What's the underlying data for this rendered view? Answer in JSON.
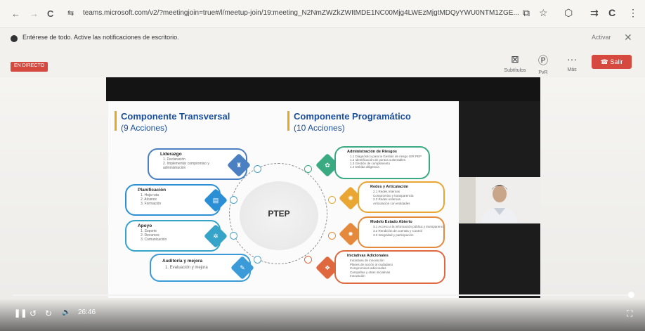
{
  "browser": {
    "url": "teams.microsoft.com/v2/?meetingjoin=true#/l/meetup-join/19:meeting_N2NmZWZkZWItMDE1NC00Mjg4LWEzMjgtMDQyYWU0NTM1ZGE...",
    "back_icon": "←",
    "forward_icon": "→",
    "reload_icon": "C",
    "site_info_icon": "⇆",
    "cast_icon": "⧉",
    "star_icon": "☆",
    "extension_icon": "⬡",
    "tab_search_icon": "⇉",
    "profile_icon": "C",
    "menu_icon": "⋮"
  },
  "notification": {
    "text": "Entérese de todo. Active las notificaciones de escritorio.",
    "activate_label": "Activar",
    "close_icon": "✕"
  },
  "meeting": {
    "live_badge": "EN DIRECTO",
    "controls": [
      {
        "icon": "⊠",
        "label": "Subtítulos"
      },
      {
        "icon": "Ⓟ",
        "label": "PvR"
      },
      {
        "icon": "···",
        "label": "Más"
      }
    ],
    "leave_icon": "☎",
    "leave_label": "Salir"
  },
  "slide": {
    "left_title": "Componente Transversal",
    "left_sub": "(9 Acciones)",
    "right_title": "Componente Programático",
    "right_sub": "(10 Acciones)",
    "center": "PTEP",
    "left_items": [
      {
        "head": "Liderazgo",
        "items": [
          "1. Declaración",
          "2. Implementar compromiso y",
          "administración"
        ],
        "icon": "♜",
        "color": "#4a7fc1"
      },
      {
        "head": "Planificación",
        "items": [
          "1. Hoja ruta",
          "2. Alcance",
          "3. Formación"
        ],
        "icon": "▤",
        "color": "#2b8fd6"
      },
      {
        "head": "Apoyo",
        "items": [
          "1. Soporte",
          "2. Recursos",
          "3. Comunicación"
        ],
        "icon": "✲",
        "color": "#36a3c9"
      },
      {
        "head": "Auditoría y mejora",
        "items": [
          "1. Evaluación y mejora"
        ],
        "icon": "✎",
        "color": "#3b9ad8"
      }
    ],
    "right_items": [
      {
        "head": "Administración de Riesgos",
        "items": [
          "1.1 Diagnóstico para la Gestión de riesgo GIR PEP",
          "1.2 Identificación de puntos vulnerables",
          "1.3 Gestión de cumplimiento",
          "1.4 Debida diligencia"
        ],
        "icon": "✿",
        "color": "#3aaa82"
      },
      {
        "head": "Redes y Articulación",
        "items": [
          "2.1 Redes Internas",
          "Compromiso y transparencia",
          "2.2 Redes externas",
          "Articulación con entidades"
        ],
        "icon": "✺",
        "color": "#e9a632"
      },
      {
        "head": "Modelo Estado Abierto",
        "items": [
          "3.1 Acceso a la información pública y transparencia",
          "3.2 Rendición de cuentas y Control",
          "3.3 Integridad y participación"
        ],
        "icon": "✹",
        "color": "#e58a3c"
      },
      {
        "head": "Iniciativas Adicionales",
        "items": [
          "Iniciativas de innovación",
          "Planes de acción al ciudadano",
          "Compromisos adicionales",
          "Campañas y otras iniciativas",
          "Innovación"
        ],
        "icon": "❖",
        "color": "#e0683e"
      }
    ]
  },
  "player": {
    "pause_icon": "❚❚",
    "back_icon": "↺",
    "fwd_icon": "↻",
    "volume_icon": "🔈",
    "time": "26:46",
    "fullscreen_icon": "⛶",
    "progress": 0.99
  }
}
